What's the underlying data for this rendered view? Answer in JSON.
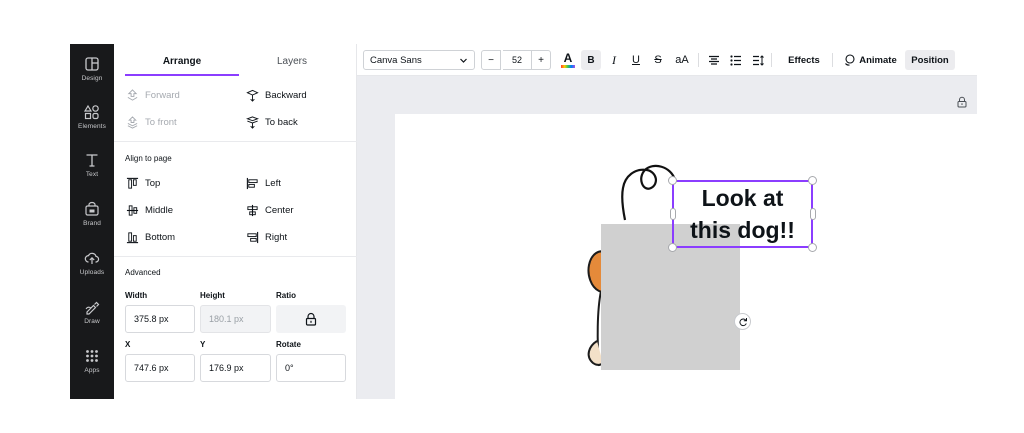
{
  "rail": {
    "items": [
      {
        "label": "Design",
        "icon": "design-icon"
      },
      {
        "label": "Elements",
        "icon": "elements-icon"
      },
      {
        "label": "Text",
        "icon": "text-icon"
      },
      {
        "label": "Brand",
        "icon": "brand-icon"
      },
      {
        "label": "Uploads",
        "icon": "uploads-icon"
      },
      {
        "label": "Draw",
        "icon": "draw-icon"
      },
      {
        "label": "Apps",
        "icon": "apps-icon"
      }
    ]
  },
  "panel": {
    "tabs": {
      "arrange": "Arrange",
      "layers": "Layers"
    },
    "order": {
      "forward": "Forward",
      "backward": "Backward",
      "to_front": "To front",
      "to_back": "To back"
    },
    "align_heading": "Align to page",
    "align": {
      "top": "Top",
      "left": "Left",
      "middle": "Middle",
      "center": "Center",
      "bottom": "Bottom",
      "right": "Right"
    },
    "advanced": {
      "heading": "Advanced",
      "width_label": "Width",
      "width_value": "375.8 px",
      "height_label": "Height",
      "height_value": "180.1 px",
      "ratio_label": "Ratio",
      "x_label": "X",
      "x_value": "747.6 px",
      "y_label": "Y",
      "y_value": "176.9 px",
      "rotate_label": "Rotate",
      "rotate_value": "0°"
    }
  },
  "toolbar": {
    "font_family": "Canva Sans",
    "font_size": "52",
    "minus": "−",
    "plus": "+",
    "text_color_glyph": "A",
    "bold_glyph": "B",
    "italic_glyph": "I",
    "underline_glyph": "U",
    "strike_glyph": "S",
    "case_glyph": "aA",
    "effects": "Effects",
    "animate": "Animate",
    "position": "Position"
  },
  "canvas": {
    "text_line1": "Look at",
    "text_line2": "this dog!!"
  },
  "colors": {
    "accent": "#8b3dff",
    "rail_bg": "#18191b",
    "workspace_bg": "#ebecf0",
    "placeholder_gray": "#d0d0d0",
    "dog_orange": "#e58a3a"
  }
}
